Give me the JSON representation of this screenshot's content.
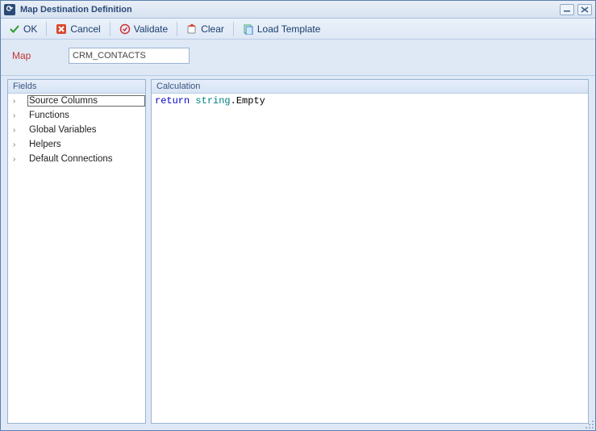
{
  "window": {
    "title": "Map Destination Definition"
  },
  "toolbar": {
    "ok": "OK",
    "cancel": "Cancel",
    "validate": "Validate",
    "clear": "Clear",
    "load_template": "Load Template"
  },
  "form": {
    "map_label": "Map",
    "map_value": "CRM_CONTACTS"
  },
  "panels": {
    "fields_header": "Fields",
    "calc_header": "Calculation"
  },
  "fields_tree": [
    {
      "label": "Source Columns",
      "selected": true
    },
    {
      "label": "Functions",
      "selected": false
    },
    {
      "label": "Global Variables",
      "selected": false
    },
    {
      "label": "Helpers",
      "selected": false
    },
    {
      "label": "Default Connections",
      "selected": false
    }
  ],
  "calculation": {
    "tokens": [
      {
        "text": "return",
        "cls": "kw-blue"
      },
      {
        "text": " ",
        "cls": ""
      },
      {
        "text": "string",
        "cls": "kw-teal"
      },
      {
        "text": ".Empty",
        "cls": ""
      }
    ]
  }
}
